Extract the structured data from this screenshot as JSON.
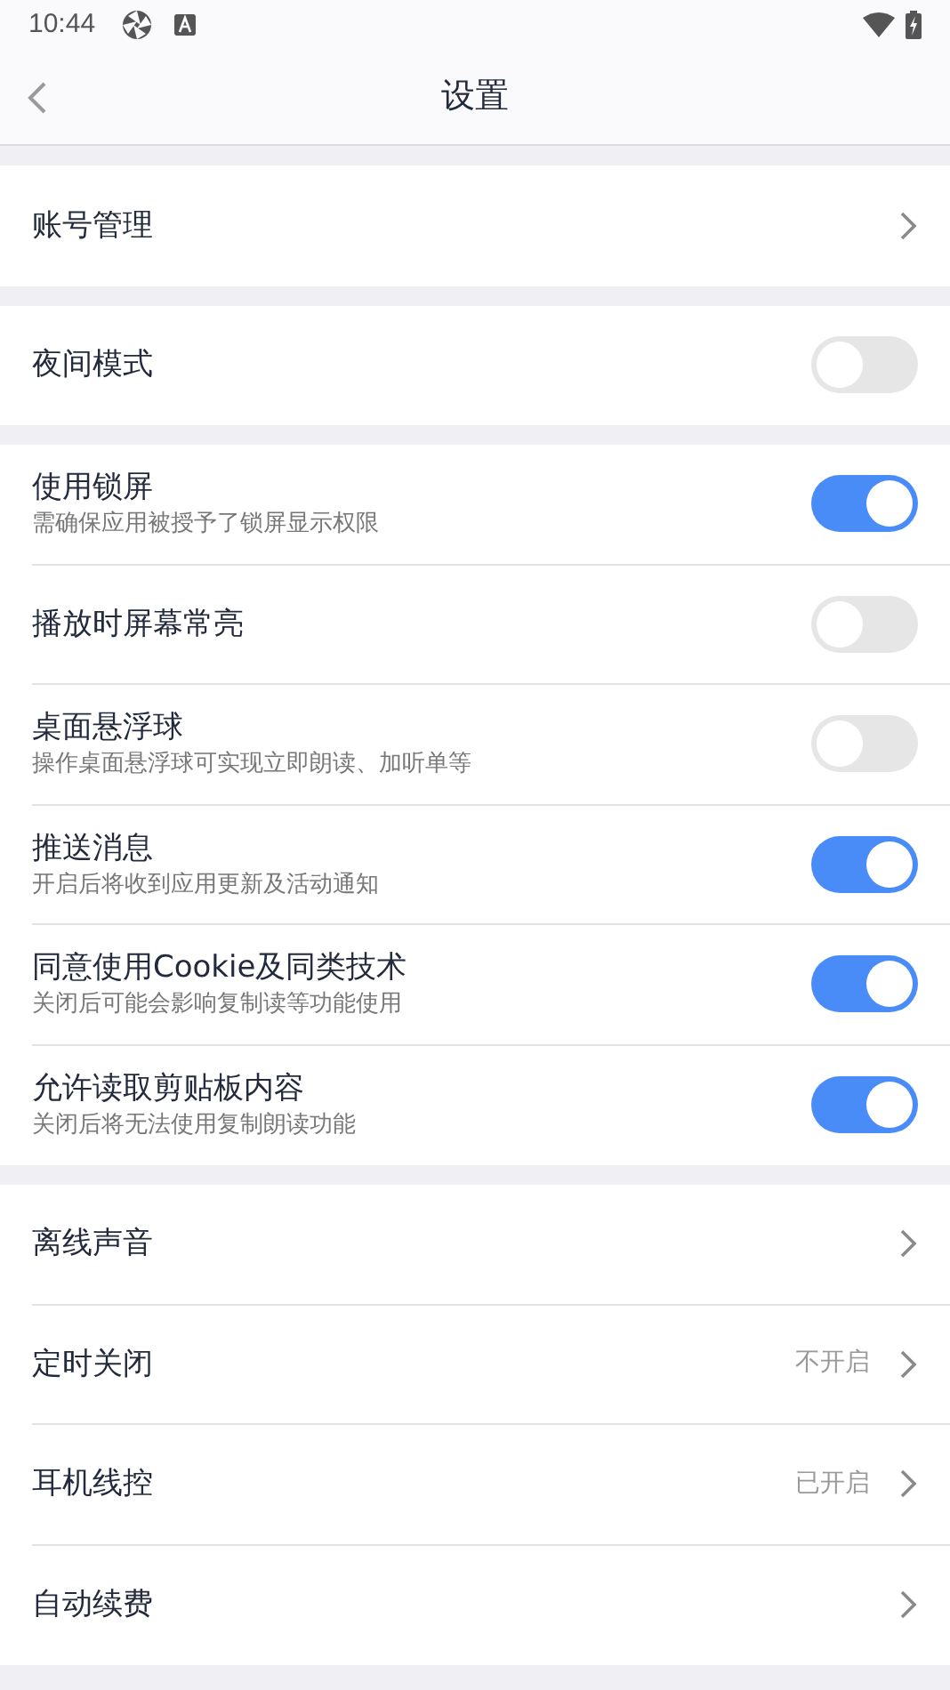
{
  "status_bar": {
    "time": "10:44"
  },
  "header": {
    "title": "设置"
  },
  "groups": [
    [
      {
        "kind": "link",
        "label": "账号管理"
      }
    ],
    [
      {
        "kind": "toggle",
        "label": "夜间模式",
        "on": false
      }
    ],
    [
      {
        "kind": "toggle",
        "label": "使用锁屏",
        "subtitle": "需确保应用被授予了锁屏显示权限",
        "on": true
      },
      {
        "kind": "toggle",
        "label": "播放时屏幕常亮",
        "on": false
      },
      {
        "kind": "toggle",
        "label": "桌面悬浮球",
        "subtitle": "操作桌面悬浮球可实现立即朗读、加听单等",
        "on": false
      },
      {
        "kind": "toggle",
        "label": "推送消息",
        "subtitle": "开启后将收到应用更新及活动通知",
        "on": true
      },
      {
        "kind": "toggle",
        "label": "同意使用Cookie及同类技术",
        "subtitle": "关闭后可能会影响复制读等功能使用",
        "on": true
      },
      {
        "kind": "toggle",
        "label": "允许读取剪贴板内容",
        "subtitle": "关闭后将无法使用复制朗读功能",
        "on": true
      }
    ],
    [
      {
        "kind": "link",
        "label": "离线声音"
      },
      {
        "kind": "link",
        "label": "定时关闭",
        "value": "不开启"
      },
      {
        "kind": "link",
        "label": "耳机线控",
        "value": "已开启"
      },
      {
        "kind": "link",
        "label": "自动续费"
      }
    ]
  ]
}
